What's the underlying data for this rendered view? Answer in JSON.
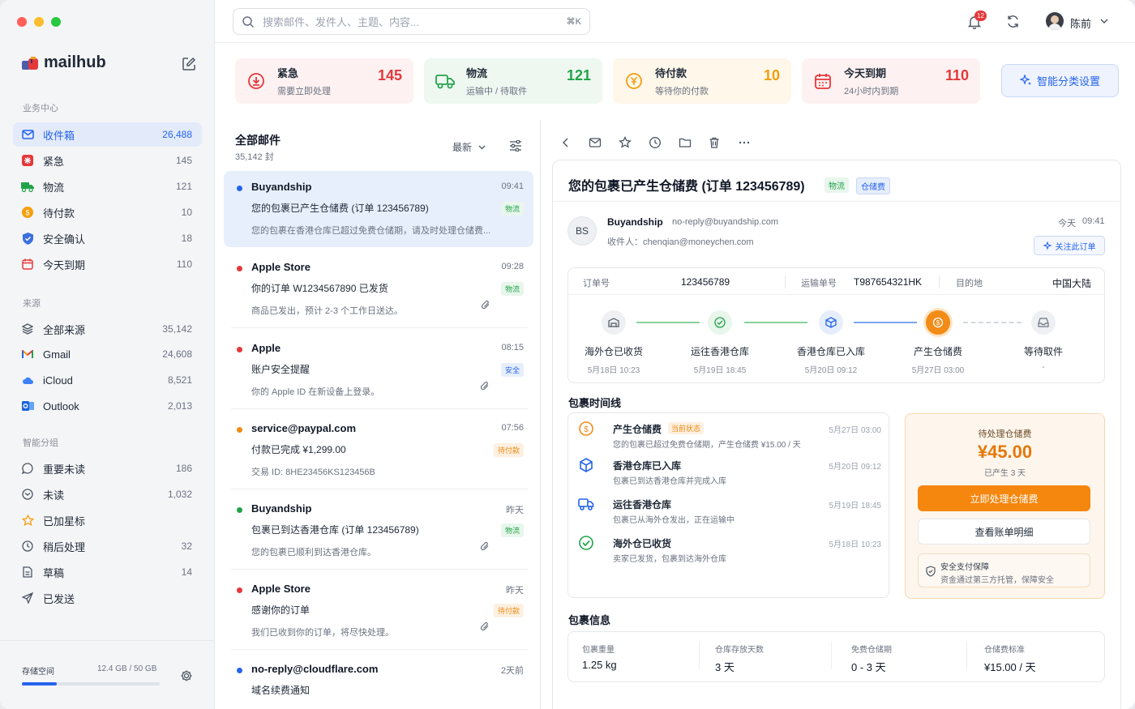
{
  "app": {
    "name": "mailhub"
  },
  "sidebar": {
    "section_business": "业务中心",
    "business": [
      {
        "label": "收件箱",
        "count": "26,488"
      },
      {
        "label": "紧急",
        "count": "145"
      },
      {
        "label": "物流",
        "count": "121"
      },
      {
        "label": "待付款",
        "count": "10"
      },
      {
        "label": "安全确认",
        "count": "18"
      },
      {
        "label": "今天到期",
        "count": "110"
      }
    ],
    "section_source": "来源",
    "sources": [
      {
        "label": "全部来源",
        "count": "35,142"
      },
      {
        "label": "Gmail",
        "count": "24,608"
      },
      {
        "label": "iCloud",
        "count": "8,521"
      },
      {
        "label": "Outlook",
        "count": "2,013"
      }
    ],
    "section_smart": "智能分组",
    "smart": [
      {
        "label": "重要未读",
        "count": "186"
      },
      {
        "label": "未读",
        "count": "1,032"
      },
      {
        "label": "已加星标",
        "count": ""
      },
      {
        "label": "稍后处理",
        "count": "32"
      },
      {
        "label": "草稿",
        "count": "14"
      },
      {
        "label": "已发送",
        "count": ""
      }
    ],
    "storage": {
      "label": "存储空间",
      "value": "12.4 GB / 50 GB",
      "fraction": 0.25
    }
  },
  "topbar": {
    "search_placeholder": "搜索邮件、发件人、主题、内容...",
    "shortcut": "⌘K",
    "notif_count": "12",
    "user_name": "陈前"
  },
  "stats": [
    {
      "title": "紧急",
      "sub": "需要立即处理",
      "count": "145",
      "color": "#e5383b"
    },
    {
      "title": "物流",
      "sub": "运输中 / 待取件",
      "count": "121",
      "color": "#22a34a"
    },
    {
      "title": "待付款",
      "sub": "等待你的付款",
      "count": "10",
      "color": "#f59e0b"
    },
    {
      "title": "今天到期",
      "sub": "24小时内到期",
      "count": "110",
      "color": "#e5383b"
    }
  ],
  "smart_button": "智能分类设置",
  "list": {
    "title": "全部邮件",
    "count": "35,142 封",
    "sort": "最新",
    "mails": [
      {
        "from": "Buyandship",
        "time": "09:41",
        "subject": "您的包裹已产生仓储费 (订单 123456789)",
        "preview": "您的包裹在香港仓库已超过免费仓储期，请及时处理仓储费...",
        "tag": "物流",
        "dot": "#2563eb"
      },
      {
        "from": "Apple Store",
        "time": "09:28",
        "subject": "你的订单 W1234567890 已发货",
        "preview": "商品已发出，预计 2-3 个工作日送达。",
        "tag": "物流",
        "dot": "#e5383b"
      },
      {
        "from": "Apple",
        "time": "08:15",
        "subject": "账户安全提醒",
        "preview": "你的 Apple ID 在新设备上登录。",
        "tag": "安全",
        "dot": "#e5383b"
      },
      {
        "from": "service@paypal.com",
        "time": "07:56",
        "subject": "付款已完成 ¥1,299.00",
        "preview": "交易 ID: 8HE23456KS123456B",
        "tag": "待付款",
        "dot": "#f08c12"
      },
      {
        "from": "Buyandship",
        "time": "昨天",
        "subject": "包裹已到达香港仓库 (订单 123456789)",
        "preview": "您的包裹已顺利到达香港仓库。",
        "tag": "物流",
        "dot": "#22a34a"
      },
      {
        "from": "Apple Store",
        "time": "昨天",
        "subject": "感谢你的订单",
        "preview": "我们已收到你的订单，将尽快处理。",
        "tag": "待付款",
        "dot": "#e5383b"
      },
      {
        "from": "no-reply@cloudflare.com",
        "time": "2天前",
        "subject": "域名续费通知",
        "preview": "",
        "tag": "",
        "dot": "#2563eb"
      }
    ]
  },
  "detail": {
    "subject": "您的包裹已产生仓储费 (订单 123456789)",
    "tags": [
      "物流",
      "仓储费"
    ],
    "avatar": "BS",
    "sender": "Buyandship",
    "sender_email": "no-reply@buyandship.com",
    "recipient": "收件人：chenqian@moneychen.com",
    "date_label": "今天",
    "time": "09:41",
    "follow_button": "关注此订单",
    "order_label": "订单号",
    "order": "123456789",
    "tracking_label": "运输单号",
    "tracking": "T987654321HK",
    "dest_label": "目的地",
    "dest": "中国大陆",
    "steps": [
      {
        "title": "海外仓已收货",
        "date": "5月18日 10:23"
      },
      {
        "title": "运往香港仓库",
        "date": "5月19日 18:45"
      },
      {
        "title": "香港仓库已入库",
        "date": "5月20日 09:12"
      },
      {
        "title": "产生仓储费",
        "date": "5月27日 03:00"
      },
      {
        "title": "等待取件",
        "date": "-"
      }
    ],
    "timeline_title": "包裹时间线",
    "timeline": [
      {
        "title": "产生仓储费",
        "badge": "当前状态",
        "desc": "您的包裹已超过免费仓储期，产生仓储费 ¥15.00 / 天",
        "date": "5月27日 03:00"
      },
      {
        "title": "香港仓库已入库",
        "badge": "",
        "desc": "包裹已到达香港仓库并完成入库",
        "date": "5月20日 09:12"
      },
      {
        "title": "运往香港仓库",
        "badge": "",
        "desc": "包裹已从海外仓发出，正在运输中",
        "date": "5月19日 18:45"
      },
      {
        "title": "海外仓已收货",
        "badge": "",
        "desc": "卖家已发货，包裹到达海外仓库",
        "date": "5月18日 10:23"
      }
    ],
    "fee": {
      "label": "待处理仓储费",
      "amount": "¥45.00",
      "days": "已产生 3 天",
      "pay_button": "立即处理仓储费",
      "bill_button": "查看账单明细",
      "secure_title": "安全支付保障",
      "secure_desc": "资金通过第三方托管，保障安全"
    },
    "info_title": "包裹信息",
    "info": [
      {
        "label": "包裹重量",
        "value": "1.25 kg"
      },
      {
        "label": "仓库存放天数",
        "value": "3 天"
      },
      {
        "label": "免费仓储期",
        "value": "0 - 3 天"
      },
      {
        "label": "仓储费标准",
        "value": "¥15.00 / 天"
      }
    ]
  }
}
